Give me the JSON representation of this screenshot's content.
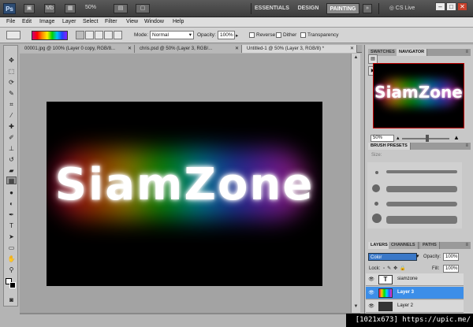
{
  "appbar": {
    "logo": "Ps",
    "mb_label": "Mb",
    "zoom": "50%",
    "workspaces": [
      "ESSENTIALS",
      "DESIGN",
      "PAINTING"
    ],
    "cs_live": "CS Live"
  },
  "menu": [
    "File",
    "Edit",
    "Image",
    "Layer",
    "Select",
    "Filter",
    "View",
    "Window",
    "Help"
  ],
  "options": {
    "mode_label": "Mode:",
    "mode_value": "Normal",
    "opacity_label": "Opacity:",
    "opacity_value": "100%",
    "reverse_label": "Reverse",
    "dither_label": "Dither",
    "transparency_label": "Transparency"
  },
  "doc_tabs": [
    "00001.jpg @ 100% (Layer 0 copy, RGB/8...",
    "chris.psd @ 50% (Layer 3, RGB/...",
    "Untitled-1 @ 50% (Layer 3, RGB/8) *"
  ],
  "document": {
    "text": "SiamZone"
  },
  "navigator": {
    "tabs": [
      "SWATCHES",
      "NAVIGATOR"
    ],
    "zoom": "50%",
    "preview_text": "SiamZone"
  },
  "brush_presets": {
    "title": "BRUSH PRESETS",
    "size_label": "Size:"
  },
  "layers": {
    "tabs": [
      "LAYERS",
      "CHANNELS",
      "PATHS"
    ],
    "blend_mode": "Color",
    "opacity_label": "Opacity:",
    "opacity_value": "100%",
    "lock_label": "Lock:",
    "fill_label": "Fill:",
    "fill_value": "100%",
    "items": [
      {
        "name": "siamzone",
        "thumb": "T"
      },
      {
        "name": "Layer 3",
        "thumb": ""
      },
      {
        "name": "Layer 2",
        "thumb": ""
      }
    ]
  },
  "watermark": "[1021x673] https://upic.me/",
  "colors": {
    "selection": "#3c8ee8",
    "close_button": "#c7402b",
    "navigator_frame": "#c00000"
  }
}
